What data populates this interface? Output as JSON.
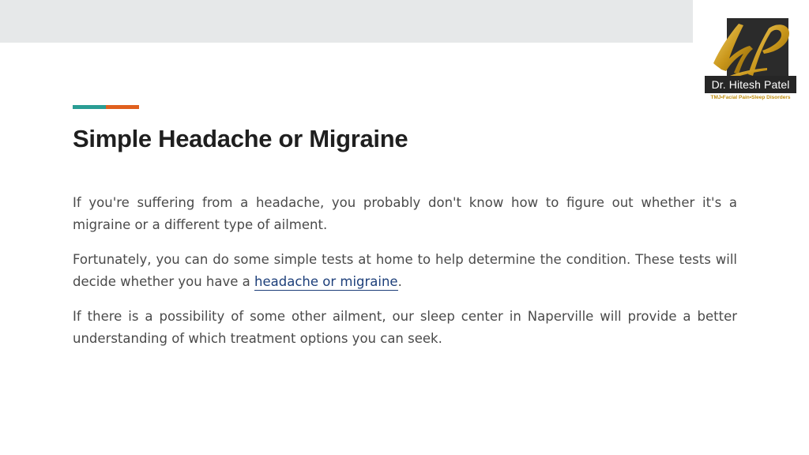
{
  "logo": {
    "monogram": "HP",
    "name": "Dr. Hitesh Patel",
    "tagline": "TMJ•Facial Pain•Sleep Disorders",
    "colors": {
      "gold": "#c9961a",
      "dark": "#262626"
    }
  },
  "accent_colors": {
    "teal": "#2a9d94",
    "orange": "#e0601e"
  },
  "title": "Simple Headache or Migraine",
  "paragraphs": {
    "p1": "If you're suffering from a headache, you probably don't know how to figure out whether it's a migraine or a different type of ailment.",
    "p2_before": "Fortunately, you can do some simple tests at home to help determine the condition. These tests will decide whether you have a ",
    "p2_link": "headache or migraine",
    "p2_after": ".",
    "p3": "If there is a possibility of some other ailment, our sleep center in Naperville will provide a better understanding of which treatment options you can seek."
  }
}
